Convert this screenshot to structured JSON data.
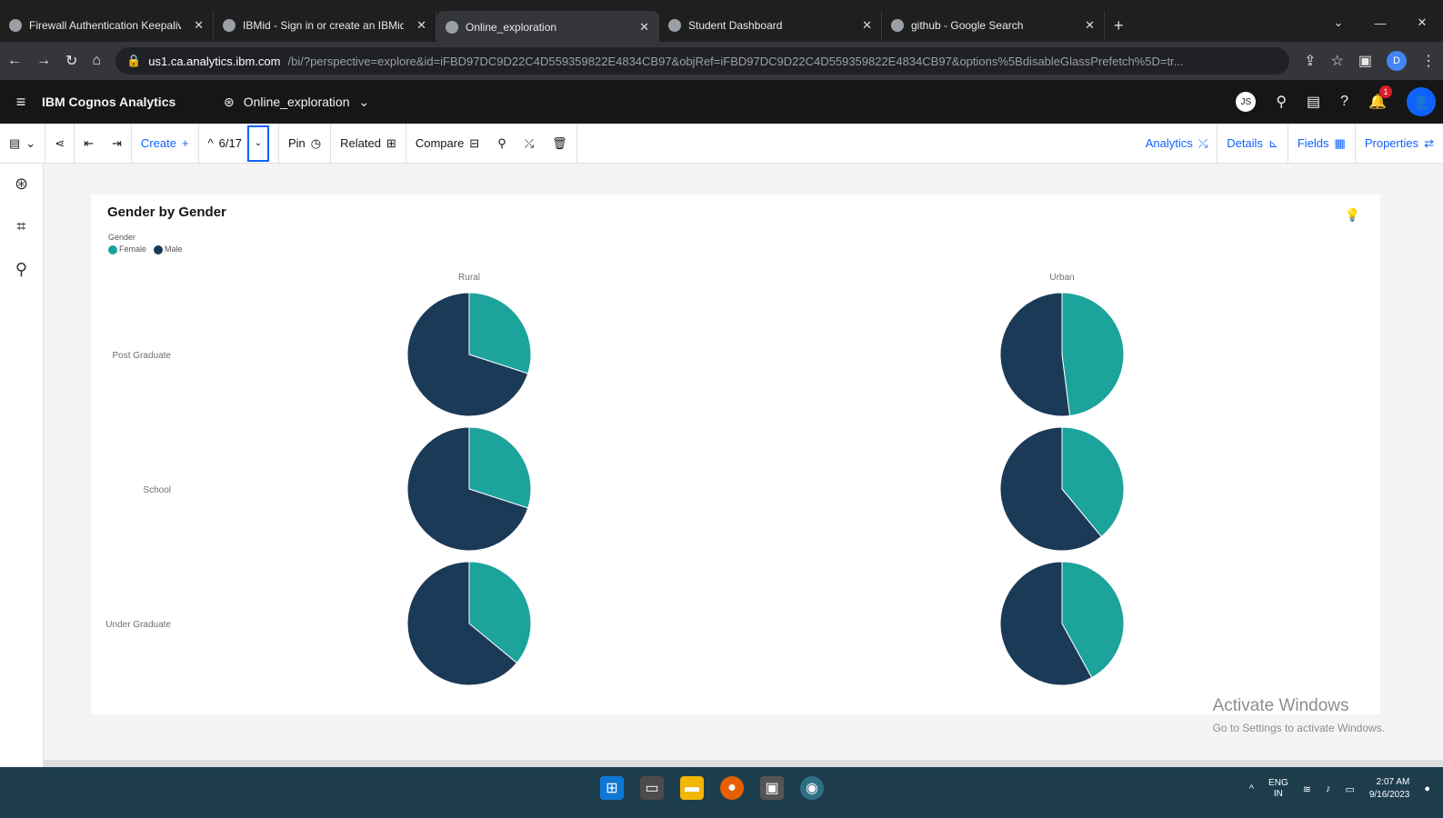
{
  "browser": {
    "tabs": [
      {
        "title": "Firewall Authentication Keepalive",
        "active": false
      },
      {
        "title": "IBMid - Sign in or create an IBMid",
        "active": false
      },
      {
        "title": "Online_exploration",
        "active": true
      },
      {
        "title": "Student Dashboard",
        "active": false
      },
      {
        "title": "github - Google Search",
        "active": false
      }
    ],
    "url_host": "us1.ca.analytics.ibm.com",
    "url_rest": "/bi/?perspective=explore&id=iFBD97DC9D22C4D559359822E4834CB97&objRef=iFBD97DC9D22C4D559359822E4834CB97&options%5BdisableGlassPrefetch%5D=tr...",
    "profile_letter": "D"
  },
  "header": {
    "brand": "IBM Cognos Analytics",
    "exploration": "Online_exploration",
    "user_initials": "JS",
    "notification_count": "1"
  },
  "toolbar": {
    "create": "Create",
    "create_plus": "+",
    "page": "6/17",
    "pin": "Pin",
    "related": "Related",
    "compare": "Compare",
    "analytics": "Analytics",
    "details": "Details",
    "fields": "Fields",
    "properties": "Properties"
  },
  "card": {
    "title": "Gender by Gender"
  },
  "chart_data": {
    "type": "pie",
    "legend_title": "Gender",
    "legend": [
      {
        "name": "Female",
        "color": "#1ba39c"
      },
      {
        "name": "Male",
        "color": "#1b3a57"
      }
    ],
    "columns": [
      "Rural",
      "Urban"
    ],
    "rows": [
      "Post Graduate",
      "School",
      "Under Graduate"
    ],
    "series": [
      {
        "name": "Female",
        "values": {
          "Rural": [
            0.3,
            0.3,
            0.36
          ],
          "Urban": [
            0.48,
            0.39,
            0.42
          ]
        }
      },
      {
        "name": "Male",
        "values": {
          "Rural": [
            0.7,
            0.7,
            0.64
          ],
          "Urban": [
            0.52,
            0.61,
            0.58
          ]
        }
      }
    ]
  },
  "watermark": {
    "line1": "Activate Windows",
    "line2": "Go to Settings to activate Windows."
  },
  "taskbar": {
    "lang1": "ENG",
    "lang2": "IN",
    "time": "2:07 AM",
    "date": "9/16/2023"
  }
}
